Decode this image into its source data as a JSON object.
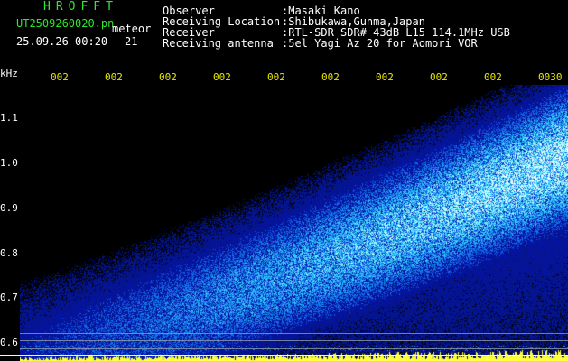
{
  "header": {
    "app_title": "HROFFT",
    "filename": "UT2509260020.pn",
    "meteor_label": "meteor",
    "timestamp": "25.09.26 00:20",
    "count": "21"
  },
  "station_info": [
    {
      "key": "Observer",
      "value": ":Masaki Kano"
    },
    {
      "key": "Receiving Location",
      "value": ":Shibukawa,Gunma,Japan"
    },
    {
      "key": "Receiver",
      "value": ":RTL-SDR SDR# 43dB L15 114.1MHz USB"
    },
    {
      "key": "Receiving antenna",
      "value": ":5el Yagi Az 20 for Aomori VOR"
    }
  ],
  "axis": {
    "unit_label": "kHz",
    "y_ticks": [
      "1.1",
      "1.0",
      "0.9",
      "0.8",
      "0.7",
      "0.6"
    ],
    "x_ticks": [
      "002",
      "002",
      "002",
      "002",
      "002",
      "002",
      "002",
      "002",
      "002",
      "0030"
    ]
  },
  "colors": {
    "label_green": "#2ee82e",
    "text_white": "#ffffff",
    "tick_yellow": "#e6e600",
    "spectrum_low": "#0a1a8c",
    "spectrum_mid": "#1e6cff",
    "spectrum_high": "#56e0ff",
    "baseline_noise": "#ffff40"
  }
}
